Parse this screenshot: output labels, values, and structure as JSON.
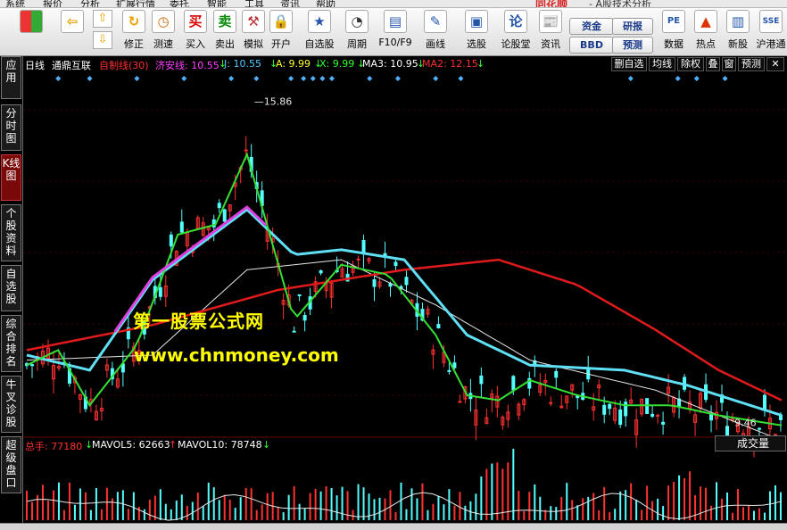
{
  "menubar": {
    "items": [
      "系统",
      "报价",
      "分析",
      "扩展行情",
      "委托",
      "智能",
      "工具",
      "资讯",
      "帮助"
    ],
    "logo": "同花顺",
    "title": "- A股技术分析"
  },
  "toolbar": {
    "buttons": [
      {
        "icon": "grid-icon",
        "label": ""
      },
      {
        "icon": "back-arrow-icon",
        "label": ""
      },
      {
        "icon": "up-down-icon",
        "label": ""
      },
      {
        "icon": "restore-icon",
        "label": "修正"
      },
      {
        "icon": "clock-icon",
        "label": "测速"
      },
      {
        "icon": "buy-icon",
        "label": "买入",
        "glyph": "买"
      },
      {
        "icon": "sell-icon",
        "label": "卖出",
        "glyph": "卖"
      },
      {
        "icon": "hammer-icon",
        "label": "模拟"
      },
      {
        "icon": "lock-icon",
        "label": "开户"
      },
      {
        "icon": "star-list-icon",
        "label": "自选股"
      },
      {
        "icon": "period-clock-icon",
        "label": "周期"
      },
      {
        "icon": "f10-icon",
        "label": "F10/F9"
      },
      {
        "icon": "pen-icon",
        "label": "画线"
      },
      {
        "icon": "select-stock-icon",
        "label": "选股"
      },
      {
        "icon": "forum-icon",
        "label": "论股堂",
        "glyph": "论"
      },
      {
        "icon": "news-icon",
        "label": "资讯"
      },
      {
        "icon": "pe-icon",
        "label": "数据",
        "glyph": "PE"
      },
      {
        "icon": "hot-icon",
        "label": "热点"
      },
      {
        "icon": "new-stock-icon",
        "label": "新股"
      },
      {
        "icon": "hk-connect-icon",
        "label": "沪港通"
      }
    ],
    "boxes": {
      "fund": "资金",
      "bbd": "BBD",
      "research": "研报",
      "forecast": "预测"
    }
  },
  "sidebar": {
    "tabs": [
      {
        "label": "应用",
        "active": false
      },
      {
        "label": "分时图",
        "active": false
      },
      {
        "label": "K线图",
        "active": true
      },
      {
        "label": "个股资料",
        "active": false
      },
      {
        "label": "自选股",
        "active": false
      },
      {
        "label": "综合排名",
        "active": false
      },
      {
        "label": "牛叉诊股",
        "active": false
      },
      {
        "label": "超级盘口",
        "active": false
      }
    ]
  },
  "infobar": {
    "period": "日线",
    "stock": "通鼎互联",
    "indicator": "自制线(30)",
    "items": [
      {
        "label": "济安线: 10.55",
        "arrow": "↓",
        "color": "#ff40ff"
      },
      {
        "label": "J: 10.55",
        "arrow": "↓",
        "color": "#50c8ff"
      },
      {
        "label": "A: 9.99",
        "arrow": "↓",
        "color": "#ffff30"
      },
      {
        "label": "X: 9.99",
        "arrow": "↓",
        "color": "#30ff30"
      },
      {
        "label": "MA3: 10.95",
        "arrow": "↓",
        "color": "#ffffff"
      },
      {
        "label": "MA2: 12.15",
        "arrow": "↓",
        "color": "#ff3030"
      }
    ],
    "buttons": [
      "删自选",
      "均线",
      "除权",
      "叠",
      "窗",
      "预测"
    ]
  },
  "chart_data": {
    "type": "candlestick",
    "price_high_label": "15.86",
    "price_low_label": "9.46",
    "ylim": [
      9.2,
      16.4
    ],
    "lines": {
      "ma2_red": [
        [
          0,
          10.9
        ],
        [
          40,
          11.4
        ],
        [
          80,
          12.1
        ],
        [
          120,
          12.5
        ],
        [
          150,
          12.7
        ],
        [
          175,
          12.2
        ],
        [
          200,
          11.3
        ],
        [
          220,
          10.5
        ],
        [
          240,
          9.9
        ]
      ],
      "ma3_white": [
        [
          0,
          10.7
        ],
        [
          40,
          10.8
        ],
        [
          70,
          12.5
        ],
        [
          100,
          12.7
        ],
        [
          130,
          11.8
        ],
        [
          160,
          10.7
        ],
        [
          200,
          10.1
        ],
        [
          240,
          9.1
        ]
      ],
      "jline_cyan": [
        [
          0,
          10.8
        ],
        [
          20,
          10.5
        ],
        [
          40,
          12.3
        ],
        [
          70,
          13.7
        ],
        [
          85,
          12.8
        ],
        [
          100,
          12.9
        ],
        [
          120,
          12.7
        ],
        [
          140,
          11.2
        ],
        [
          160,
          10.6
        ],
        [
          190,
          10.5
        ],
        [
          210,
          10.2
        ],
        [
          240,
          9.6
        ]
      ],
      "ajx_yellow_green": [
        [
          0,
          10.6
        ],
        [
          10,
          10.9
        ],
        [
          20,
          9.8
        ],
        [
          35,
          11.0
        ],
        [
          48,
          13.2
        ],
        [
          60,
          13.4
        ],
        [
          70,
          14.8
        ],
        [
          85,
          11.5
        ],
        [
          100,
          12.6
        ],
        [
          115,
          12.4
        ],
        [
          130,
          11.2
        ],
        [
          140,
          10.0
        ],
        [
          150,
          9.9
        ],
        [
          160,
          10.3
        ],
        [
          175,
          10.0
        ],
        [
          190,
          9.8
        ],
        [
          205,
          9.8
        ],
        [
          220,
          9.6
        ],
        [
          240,
          9.4
        ]
      ]
    }
  },
  "volume": {
    "total": "总手: 77180",
    "ma5": "MAVOL5: 62663",
    "ma10": "MAVOL10: 78748",
    "selector": "成交量"
  },
  "watermark": {
    "line1": "第一股票公式网",
    "line2": "www.chnmoney.com"
  }
}
